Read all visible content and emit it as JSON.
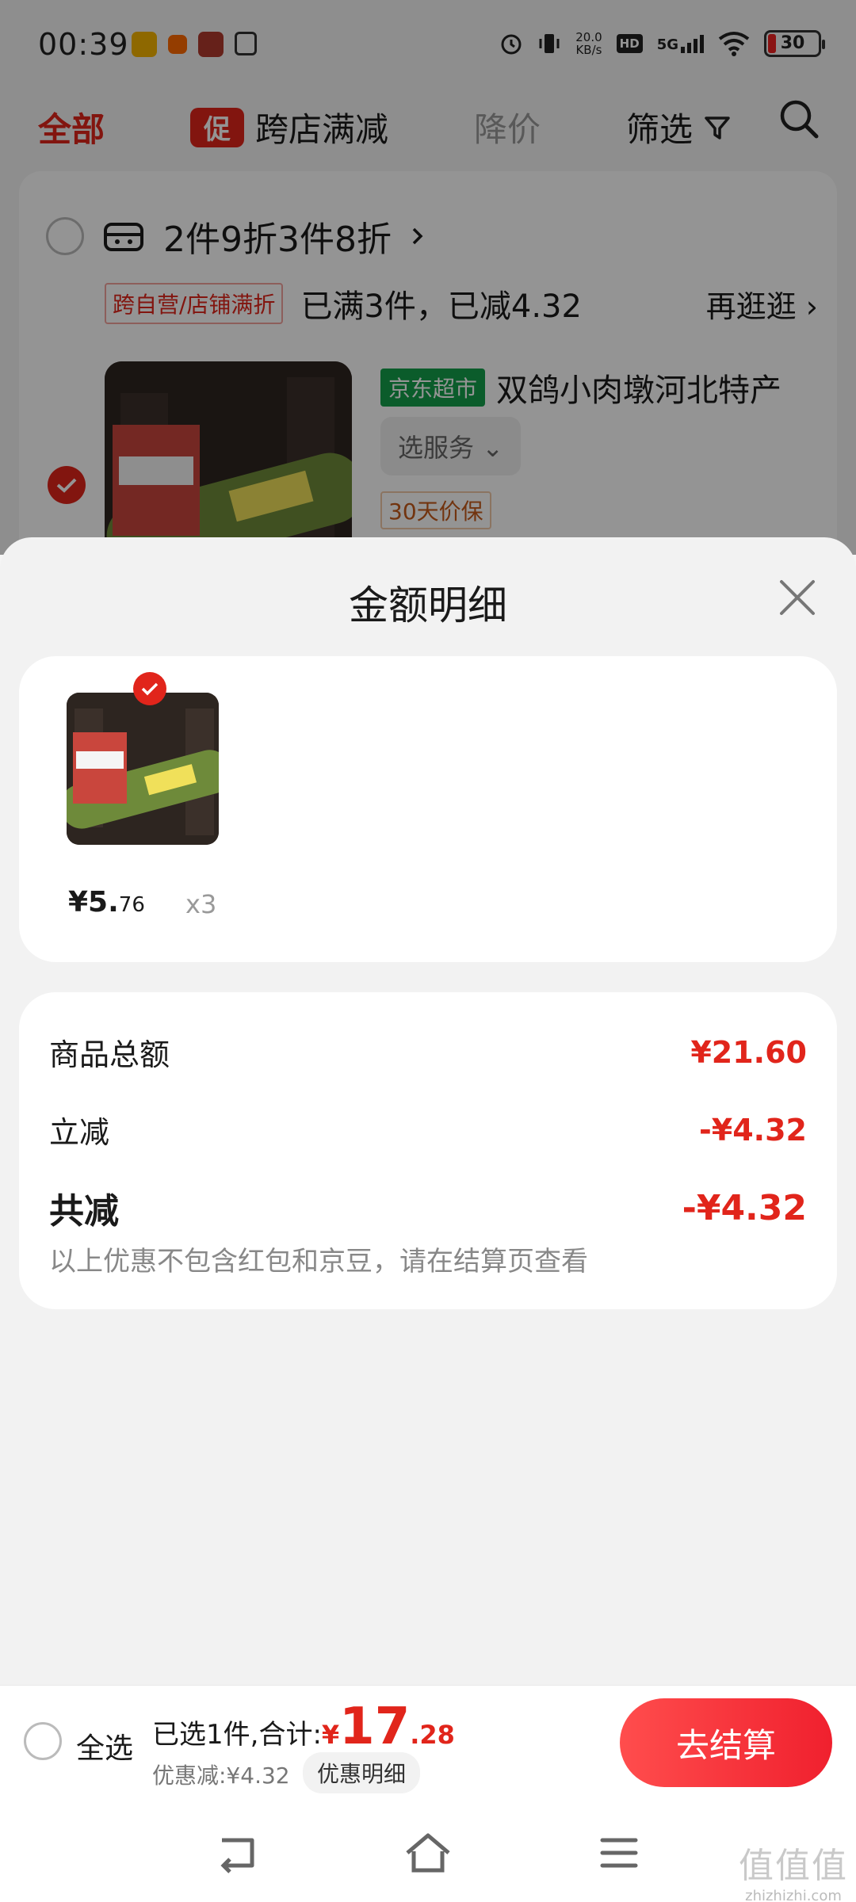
{
  "status": {
    "time": "00:39",
    "net_speed_value": "20.0",
    "net_speed_unit": "KB/s",
    "hd": "HD",
    "signal": "5G",
    "battery": "30"
  },
  "tabs": {
    "all": "全部",
    "promo_badge": "促",
    "cross_store": "跨店满减",
    "price_drop": "降价",
    "filter": "筛选"
  },
  "cart": {
    "shop_title": "2件9折3件8折",
    "promo_tag": "跨自营/店铺满折",
    "promo_text": "已满3件，已减4.32",
    "promo_more": "再逛逛",
    "item_store_tag": "京东超市",
    "item_name": "双鸽小肉墩河北特产",
    "service_button": "选服务",
    "price_guarantee": "30天价保"
  },
  "sheet": {
    "title": "金额明细",
    "item_price_int": "¥5.",
    "item_price_dec": "76",
    "item_qty": "x3",
    "rows": [
      {
        "label": "商品总额",
        "value": "¥21.60"
      },
      {
        "label": "立减",
        "value": "-¥4.32"
      },
      {
        "label": "共减",
        "value": "-¥4.32"
      }
    ],
    "note": "以上优惠不包含红包和京豆，请在结算页查看"
  },
  "checkout": {
    "select_all": "全选",
    "selected_text": "已选1件,合计:",
    "yen": "¥",
    "total_int": "17",
    "total_dec": ".28",
    "discount_text": "优惠减:¥4.32",
    "discount_detail": "优惠明细",
    "submit": "去结算"
  },
  "watermark": {
    "cn": "值值值",
    "url": "zhizhizhi.com"
  },
  "colors": {
    "accent": "#e1251b",
    "jd_green": "#149f4b",
    "sheet_bg": "#f2f2f2"
  }
}
